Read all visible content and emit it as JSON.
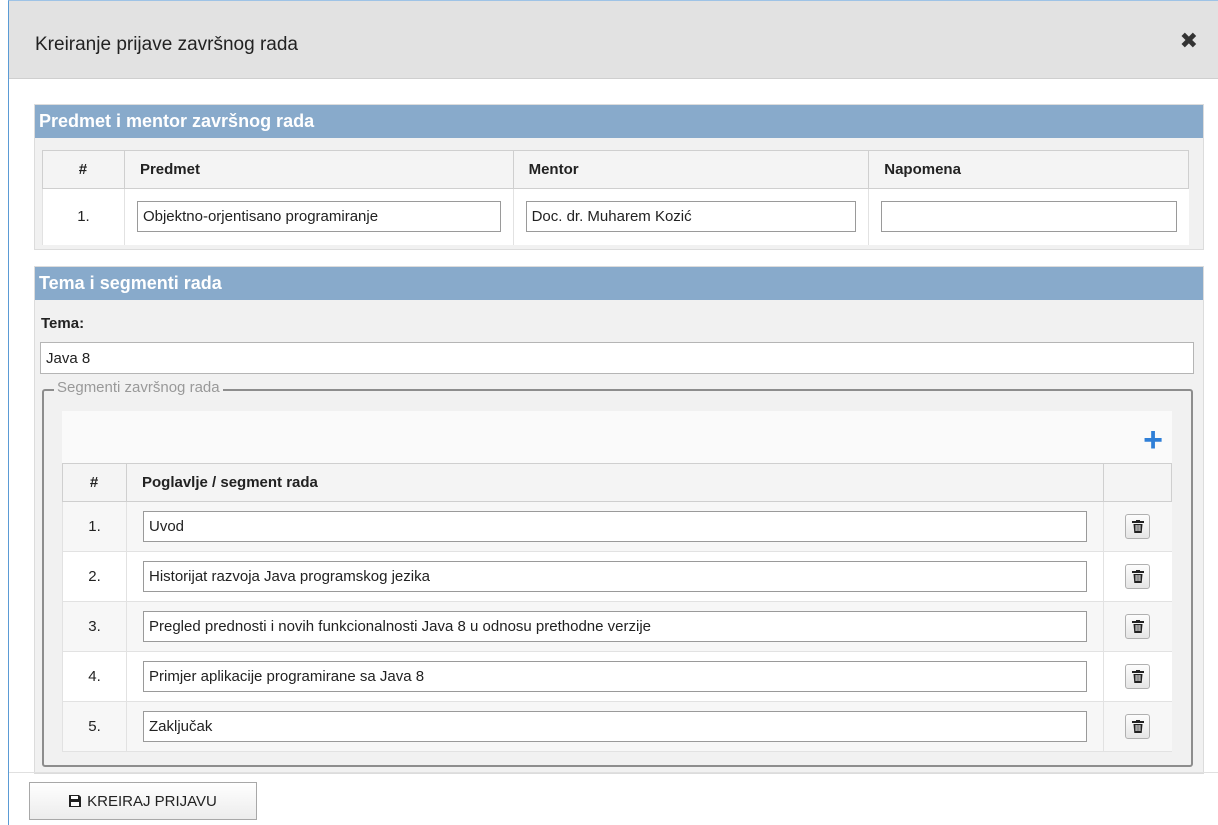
{
  "modal": {
    "title": "Kreiranje prijave završnog rada",
    "close_label": "✖"
  },
  "section1": {
    "title": "Predmet i mentor završnog rada",
    "columns": [
      "#",
      "Predmet",
      "Mentor",
      "Napomena"
    ],
    "row": {
      "num": "1.",
      "predmet": "Objektno-orjentisano programiranje",
      "mentor": "Doc. dr. Muharem Kozić",
      "napomena": ""
    }
  },
  "section2": {
    "title": "Tema i segmenti rada",
    "tema_label": "Tema:",
    "tema_value": "Java 8",
    "legend": "Segmenti završnog rada",
    "add_label": "+",
    "columns": [
      "#",
      "Poglavlje / segment rada",
      ""
    ],
    "segments": [
      {
        "num": "1.",
        "value": "Uvod"
      },
      {
        "num": "2.",
        "value": "Historijat razvoja Java programskog jezika"
      },
      {
        "num": "3.",
        "value": "Pregled prednosti i novih funkcionalnosti Java 8 u odnosu prethodne verzije"
      },
      {
        "num": "4.",
        "value": "Primjer aplikacije programirane sa Java 8"
      },
      {
        "num": "5.",
        "value": "Zaključak"
      }
    ]
  },
  "footer": {
    "create_label": "KREIRAJ PRIJAVU"
  },
  "colors": {
    "panel_header": "#88aacb",
    "accent": "#2f7fd7",
    "header_bg": "#e2e2e2"
  },
  "icons": {
    "close": "close-icon",
    "add": "plus-icon",
    "delete": "trash-icon",
    "save": "save-icon"
  }
}
